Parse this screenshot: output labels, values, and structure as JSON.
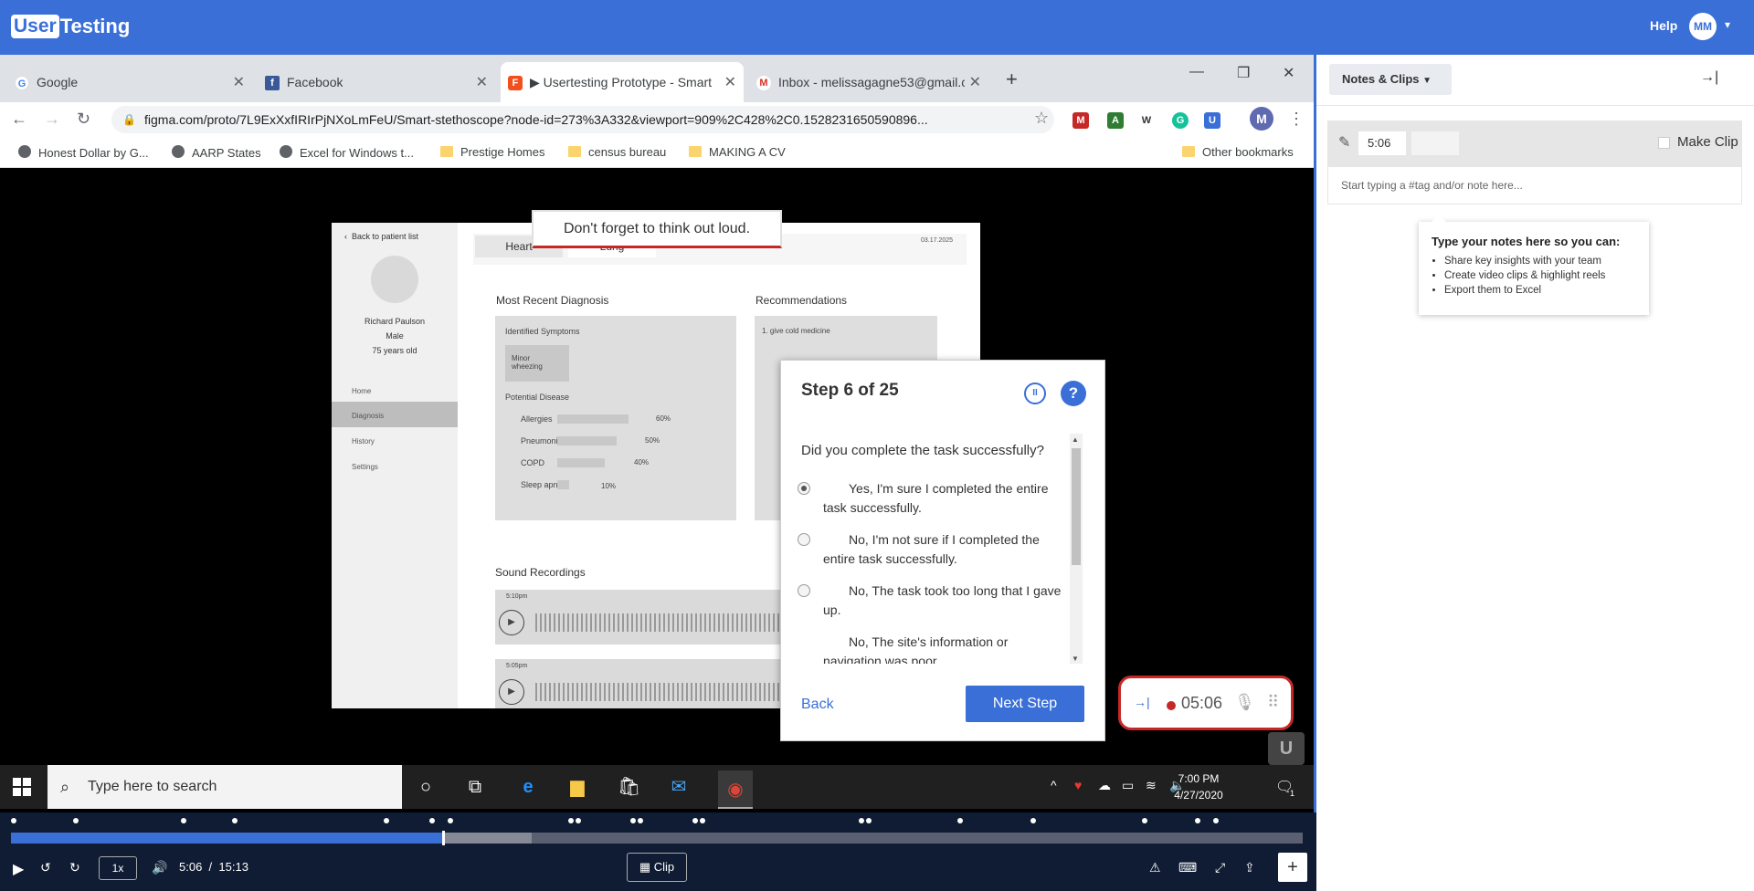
{
  "usertesting": {
    "logo_a": "User",
    "logo_b": "Testing",
    "help": "Help",
    "avatar": "MM"
  },
  "browser": {
    "tabs": [
      {
        "label": "Google",
        "icon": "google-icon"
      },
      {
        "label": "Facebook",
        "icon": "facebook-icon"
      },
      {
        "label": "▶ Usertesting Prototype - Smart",
        "icon": "figma-icon"
      },
      {
        "label": "Inbox - melissagagne53@gmail.c",
        "icon": "gmail-icon"
      }
    ],
    "url": "figma.com/proto/7L9ExXxfIRIrPjNXoLmFeU/Smart-stethoscope?node-id=273%3A332&viewport=909%2C428%2C0.1528231650590896...",
    "bookmarks": [
      "Honest Dollar by G...",
      "AARP States",
      "Excel for Windows t...",
      "Prestige Homes",
      "census bureau",
      "MAKING A CV"
    ],
    "other_bookmarks": "Other bookmarks",
    "profile": "M"
  },
  "prototype": {
    "back": "Back to patient list",
    "patient_name": "Richard Paulson",
    "patient_sex": "Male",
    "patient_age": "75 years old",
    "nav": [
      "Home",
      "Diagnosis",
      "History",
      "Settings"
    ],
    "tabs": [
      "Heart",
      "Lung"
    ],
    "date": "03.17.2025",
    "diagnosis_title": "Most Recent Diagnosis",
    "identified": "Identified Symptoms",
    "symptom": "Minor wheezing",
    "potential": "Potential Disease",
    "diseases": [
      {
        "name": "Allergies",
        "pct": "60%",
        "value": 60
      },
      {
        "name": "Pneumonia",
        "pct": "50%",
        "value": 50
      },
      {
        "name": "COPD",
        "pct": "40%",
        "value": 40
      },
      {
        "name": "Sleep apnea",
        "pct": "10%",
        "value": 10
      }
    ],
    "recommendations_title": "Recommendations",
    "recommendation": "1. give cold medicine",
    "sound_title": "Sound Recordings",
    "recordings": [
      "5:10pm",
      "5:05pm"
    ]
  },
  "think_aloud": "Don't forget to think out loud.",
  "step": {
    "title": "Step 6 of 25",
    "question": "Did you complete the task successfully?",
    "options": [
      "Yes, I'm sure I completed the entire task successfully.",
      "No, I'm not sure if I completed the entire task successfully.",
      "No, The task took too long that I gave up.",
      "No, The site's information or navigation was poor."
    ],
    "selected_option": 0,
    "back": "Back",
    "next": "Next Step"
  },
  "recorder": {
    "time": "05:06"
  },
  "taskbar": {
    "search_placeholder": "Type here to search",
    "time": "7:00 PM",
    "date": "4/27/2020",
    "notification_count": "1"
  },
  "notes": {
    "dropdown": "Notes & Clips",
    "time": "5:06",
    "make_clip": "Make Clip",
    "placeholder": "Start typing a #tag and/or note here...",
    "tip_title": "Type your notes here so you can:",
    "tip_items": [
      "Share key insights with your team",
      "Create video clips & highlight reels",
      "Export them to Excel"
    ]
  },
  "player": {
    "speed": "1x",
    "current": "5:06",
    "separator": "/",
    "total": "15:13",
    "clip": "Clip",
    "progress_fraction": 0.335
  },
  "colors": {
    "brand": "#3a6fd8",
    "record": "#c62828",
    "player_bg": "#0f1c33"
  }
}
